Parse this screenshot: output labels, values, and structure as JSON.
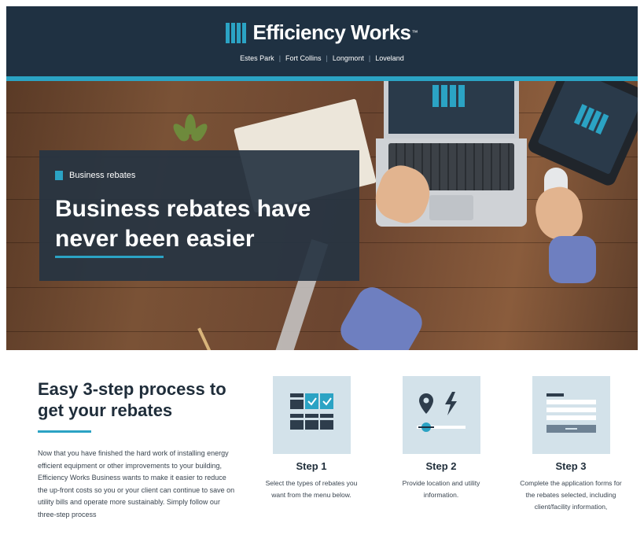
{
  "header": {
    "brand_name": "Efficiency Works",
    "brand_tm": "™",
    "cities": [
      "Estes Park",
      "Fort Collins",
      "Longmont",
      "Loveland"
    ],
    "separator": "|"
  },
  "hero": {
    "eyebrow": "Business rebates",
    "title": "Business rebates have never been easier"
  },
  "process": {
    "title": "Easy 3-step process to get your rebates",
    "body": "Now that you have finished the hard work of installing energy efficient equipment or other improvements to your building, Efficiency Works Business wants to make it easier to reduce the up-front costs so you or your client can continue to save on utility bills and operate more sustainably. Simply follow our three-step process",
    "steps": [
      {
        "title": "Step 1",
        "desc": "Select the types of rebates you want from the menu below.",
        "icon": "checklist-grid-icon"
      },
      {
        "title": "Step 2",
        "desc": "Provide location and utility information.",
        "icon": "location-utility-icon"
      },
      {
        "title": "Step 3",
        "desc": "Complete the application forms for the rebates selected, including client/facility information,",
        "icon": "application-form-icon"
      }
    ]
  },
  "colors": {
    "navy": "#1f3142",
    "accent": "#2ba3c4",
    "tile": "#d3e2ea"
  }
}
